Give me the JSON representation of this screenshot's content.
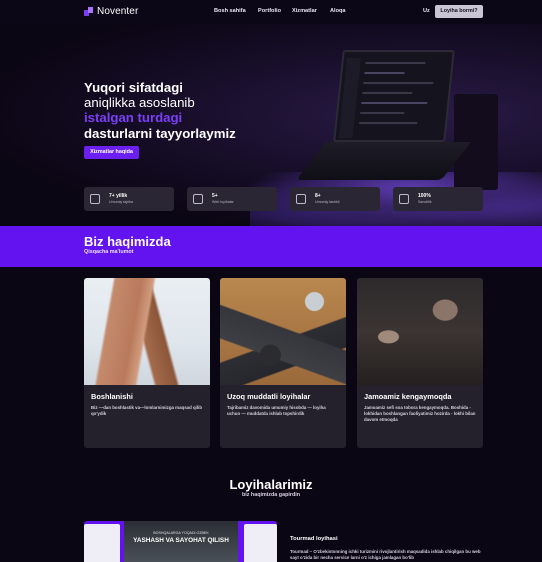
{
  "nav": {
    "brand": "Noventer",
    "items": [
      "Bosh sahifa",
      "Portfolio",
      "Xizmatlar",
      "Aloqa"
    ],
    "language": "Uz",
    "cta": "Loyiha bormi?"
  },
  "hero": {
    "title_line1": "Yuqori sifatdagi",
    "title_line2": "aniqlikka asoslanib",
    "title_line3": "istalgan turdagi",
    "title_line4": "dasturlarni tayyorlaymiz",
    "button": "Xizmatlar haqida"
  },
  "stats": [
    {
      "value": "7+ yillik",
      "label": "Umumiy tajriba",
      "icon": "chart-icon"
    },
    {
      "value": "5+",
      "label": "Web loyihalar",
      "icon": "dollar-icon"
    },
    {
      "value": "8+",
      "label": "Umumiy tashkil",
      "icon": "camera-icon"
    },
    {
      "value": "100%",
      "label": "Sanoitlik",
      "icon": "basket-icon"
    }
  ],
  "about": {
    "title": "Biz haqimizda",
    "subtitle": "Qisqacha ma'lumot"
  },
  "cards": [
    {
      "title": "Boshlanishi",
      "desc": "Biz —dan boshlastik va—lomlarnimizga maqsad qilib qo'ydik"
    },
    {
      "title": "Uzoq muddatli loyihalar",
      "desc": "Tajribamiz davomida umumiy hisobda — loyiha uchun — muddatda ishlab topshirdik"
    },
    {
      "title": "Jamoamiz kengaymoqda",
      "desc": "Jamoamiz sefi soa tobora kengaymoqda. Boshida - lokhidan boshlangan faoliyatimiz hozirda - lokhi bilan davom etmoqda"
    }
  ],
  "projects": {
    "title": "Loyihalarimiz",
    "subtitle": "biz haqimizda gapirdin",
    "item": {
      "image_caption_small": "BOSHQALARGA YOQADI OZBEK",
      "image_caption_big": "YASHASH VA SAYOHAT QILISH",
      "name": "Tourmad loyihasi",
      "desc": "Tourmad – O'zbekistonning ichki turizmini rivojlantirish maqsadida ishlab chiqilgan bu web sayt o'zida bir necha service larni o'z ichiga jamlagan bo'lib"
    }
  },
  "colors": {
    "accent": "#6313f0",
    "background": "#0b0614",
    "card": "#24212c"
  }
}
